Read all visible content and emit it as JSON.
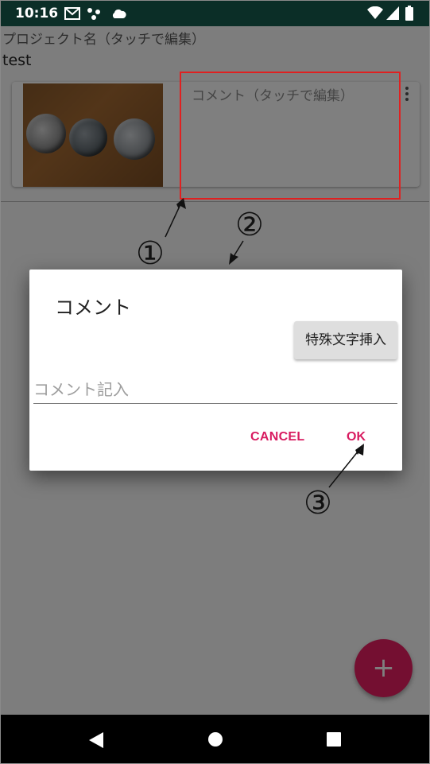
{
  "status_bar": {
    "time": "10:16",
    "icons": [
      "gmail-icon",
      "dots-icon",
      "cloud-icon",
      "wifi-icon",
      "signal-icon",
      "battery-icon"
    ]
  },
  "project": {
    "label": "プロジェクト名（タッチで編集）",
    "name": "test"
  },
  "card": {
    "comment_hint": "コメント（タッチで編集）"
  },
  "dialog": {
    "title": "コメント",
    "special_button": "特殊文字挿入",
    "input_placeholder": "コメント記入",
    "input_value": "",
    "cancel_label": "CANCEL",
    "ok_label": "OK"
  },
  "annotations": {
    "one": "①",
    "two": "②",
    "three": "③"
  },
  "fab": {
    "symbol": "+"
  },
  "colors": {
    "accent": "#d81b60",
    "fab": "#e91e63",
    "status_bar": "#0b2e27",
    "annotation_box": "#e02020"
  }
}
